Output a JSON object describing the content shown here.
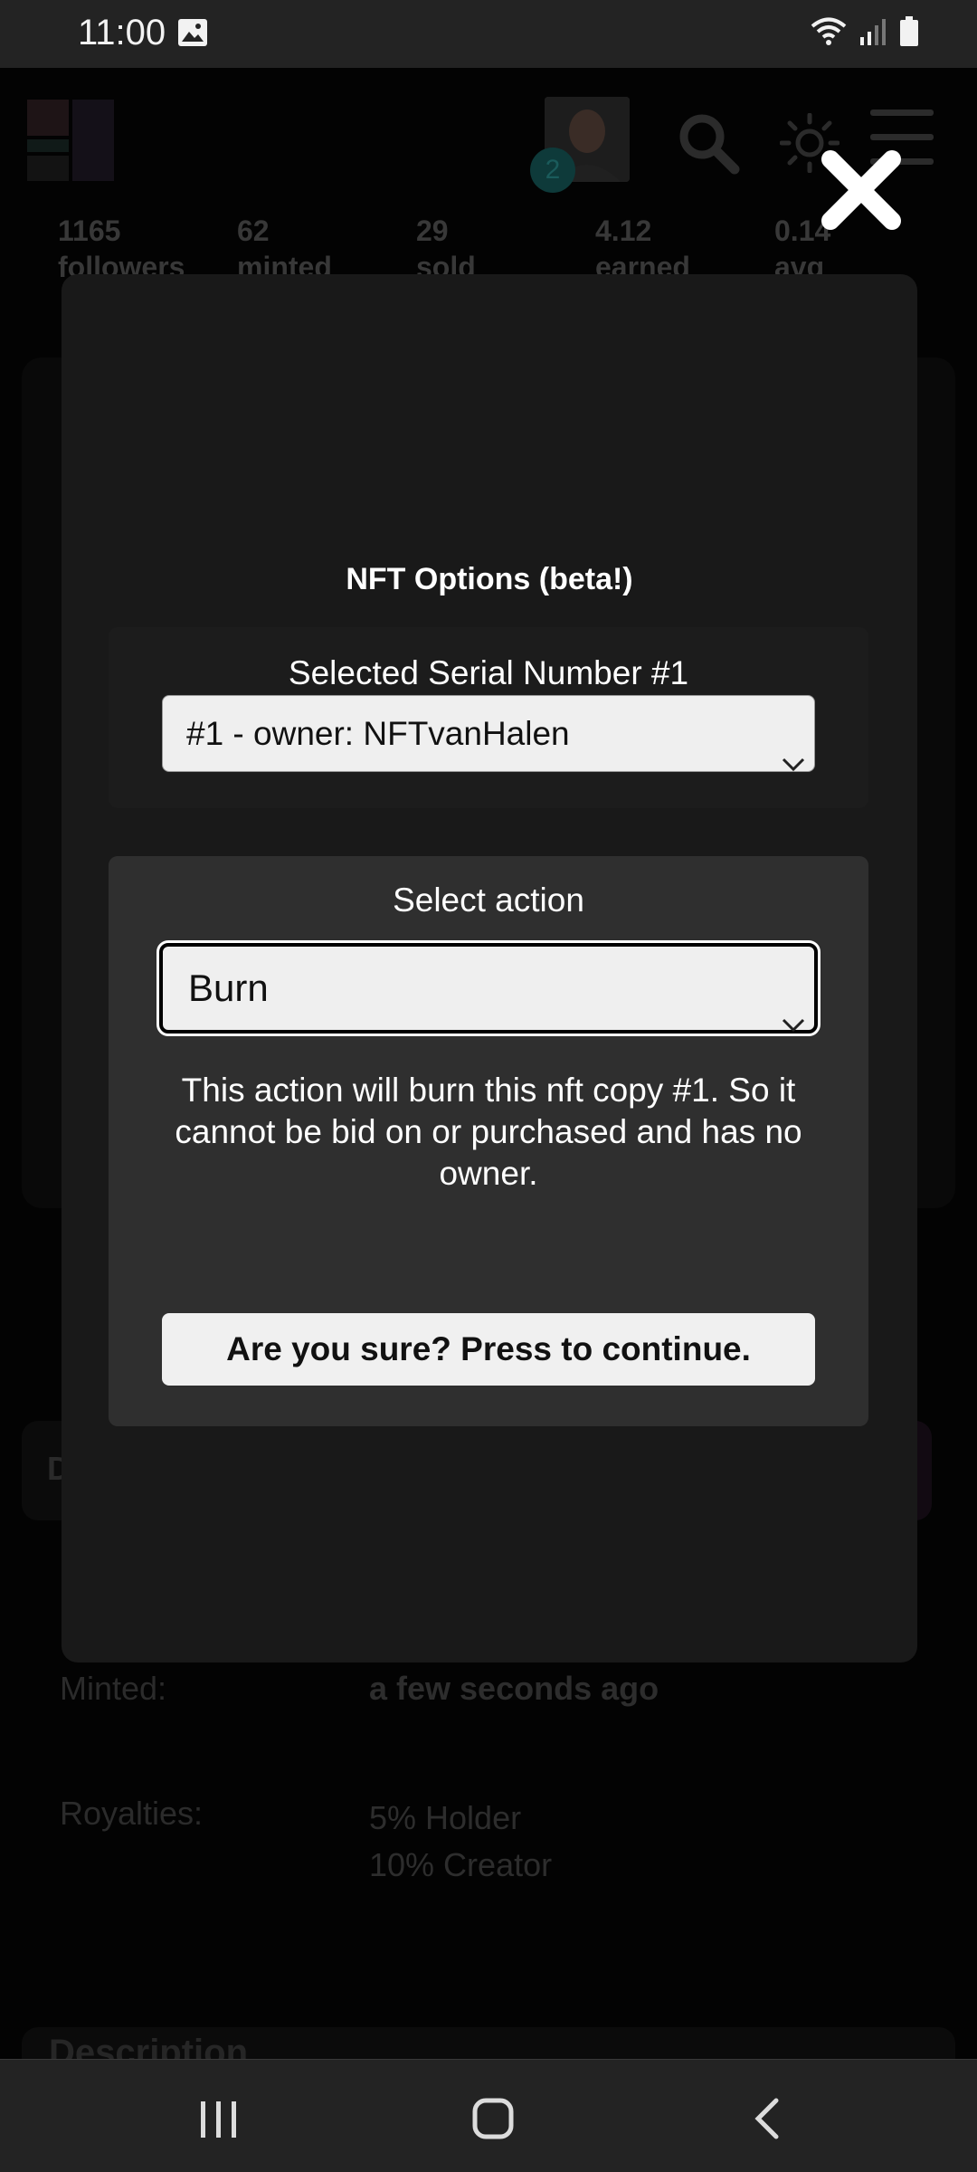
{
  "status_bar": {
    "time": "11:00",
    "icons": [
      "gallery-icon",
      "wifi-icon",
      "signal-icon",
      "battery-icon"
    ]
  },
  "background_page": {
    "notification_count": "2",
    "stats": [
      {
        "value": "1165",
        "label": "followers"
      },
      {
        "value": "62",
        "label": "minted"
      },
      {
        "value": "29",
        "label": "sold"
      },
      {
        "value": "4.12",
        "label": "earned"
      },
      {
        "value": "0.14",
        "label": "avg"
      }
    ],
    "details_letter": "D",
    "minted_label": "Minted:",
    "minted_value": "a few seconds ago",
    "royalties_label": "Royalties:",
    "royalties_holder": "5% Holder",
    "royalties_creator": "10% Creator",
    "description_heading": "Description"
  },
  "modal": {
    "title": "NFT Options (beta!)",
    "serial_label": "Selected Serial Number #1",
    "serial_selected": "#1 - owner: NFTvanHalen",
    "action_label": "Select action",
    "action_selected": "Burn",
    "action_description": "This action will burn this nft copy #1. So it cannot be bid on or purchased and has no owner.",
    "continue_label": "Are you sure? Press to continue."
  },
  "colors": {
    "modal_bg": "#191919",
    "panel_bg": "#2f2f2f",
    "select_bg": "#efefef",
    "text": "#ffffff"
  }
}
